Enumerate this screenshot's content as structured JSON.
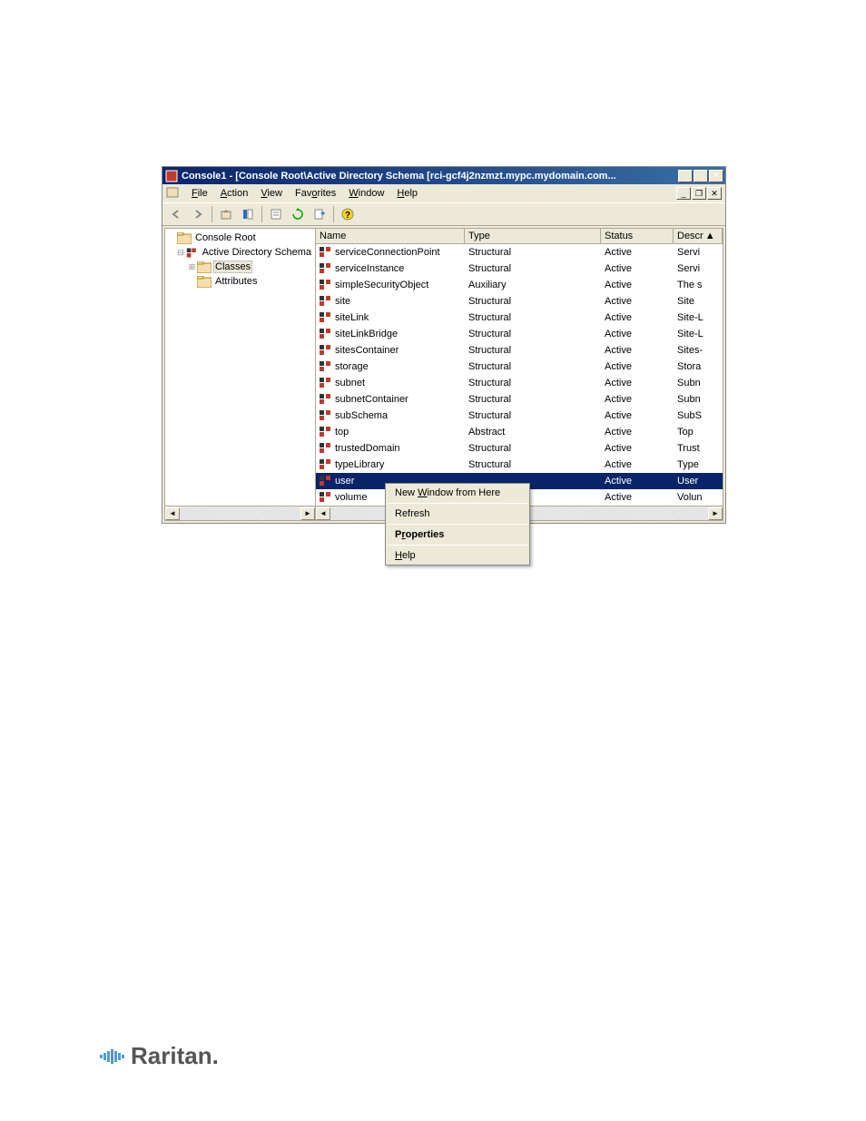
{
  "window": {
    "title": "Console1 - [Console Root\\Active Directory Schema [rci-gcf4j2nzmzt.mypc.mydomain.com..."
  },
  "menubar": {
    "file": "File",
    "action": "Action",
    "view": "View",
    "favorites": "Favorites",
    "window": "Window",
    "help": "Help"
  },
  "tree": {
    "root": "Console Root",
    "schema": "Active Directory Schema",
    "classes": "Classes",
    "attributes": "Attributes"
  },
  "list": {
    "headers": {
      "name": "Name",
      "type": "Type",
      "status": "Status",
      "desc": "Descr"
    },
    "rows": [
      {
        "name": "serviceConnectionPoint",
        "type": "Structural",
        "status": "Active",
        "desc": "Servi"
      },
      {
        "name": "serviceInstance",
        "type": "Structural",
        "status": "Active",
        "desc": "Servi"
      },
      {
        "name": "simpleSecurityObject",
        "type": "Auxiliary",
        "status": "Active",
        "desc": "The s"
      },
      {
        "name": "site",
        "type": "Structural",
        "status": "Active",
        "desc": "Site"
      },
      {
        "name": "siteLink",
        "type": "Structural",
        "status": "Active",
        "desc": "Site-L"
      },
      {
        "name": "siteLinkBridge",
        "type": "Structural",
        "status": "Active",
        "desc": "Site-L"
      },
      {
        "name": "sitesContainer",
        "type": "Structural",
        "status": "Active",
        "desc": "Sites-"
      },
      {
        "name": "storage",
        "type": "Structural",
        "status": "Active",
        "desc": "Stora"
      },
      {
        "name": "subnet",
        "type": "Structural",
        "status": "Active",
        "desc": "Subn"
      },
      {
        "name": "subnetContainer",
        "type": "Structural",
        "status": "Active",
        "desc": "Subn"
      },
      {
        "name": "subSchema",
        "type": "Structural",
        "status": "Active",
        "desc": "SubS"
      },
      {
        "name": "top",
        "type": "Abstract",
        "status": "Active",
        "desc": "Top"
      },
      {
        "name": "trustedDomain",
        "type": "Structural",
        "status": "Active",
        "desc": "Trust"
      },
      {
        "name": "typeLibrary",
        "type": "Structural",
        "status": "Active",
        "desc": "Type"
      },
      {
        "name": "user",
        "type": "",
        "status": "Active",
        "desc": "User",
        "selected": true
      },
      {
        "name": "volume",
        "type": "",
        "status": "Active",
        "desc": "Volun"
      }
    ]
  },
  "context_menu": {
    "new_window": "New Window from Here",
    "refresh": "Refresh",
    "properties": "Properties",
    "help": "Help"
  },
  "logo": "Raritan."
}
